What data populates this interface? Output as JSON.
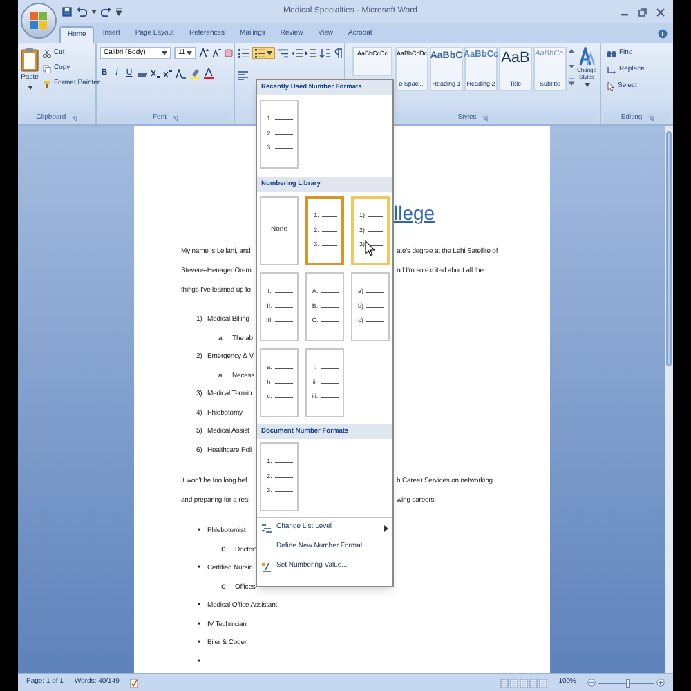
{
  "window": {
    "title": "Medical Specialties - Microsoft Word"
  },
  "ribbon_tabs": [
    {
      "label": "Home",
      "selected": true
    },
    {
      "label": "Insert",
      "selected": false
    },
    {
      "label": "Page Layout",
      "selected": false
    },
    {
      "label": "References",
      "selected": false
    },
    {
      "label": "Mailings",
      "selected": false
    },
    {
      "label": "Review",
      "selected": false
    },
    {
      "label": "View",
      "selected": false
    },
    {
      "label": "Acrobat",
      "selected": false
    }
  ],
  "clipboard": {
    "paste": "Paste",
    "cut": "Cut",
    "copy": "Copy",
    "format_painter": "Format Painter",
    "label": "Clipboard"
  },
  "font": {
    "name": "Calibri (Body)",
    "size": "11",
    "format_buttons": [
      "B",
      "I",
      "U"
    ],
    "label": "Font"
  },
  "paragraph": {
    "numbering_pressed": true
  },
  "styles": {
    "items": [
      {
        "kind": "normal",
        "sample": "AaBbCcDc"
      },
      {
        "kind": "normal",
        "sample": "AaBbCcDc",
        "label": "o Spaci..."
      },
      {
        "kind": "heading1",
        "sample": "AaBbC",
        "label": "Heading 1"
      },
      {
        "kind": "heading2",
        "sample": "AaBbCc",
        "label": "Heading 2"
      },
      {
        "kind": "title",
        "sample": "AaB",
        "label": "Title"
      },
      {
        "kind": "subtitle",
        "sample": "AaBbCc.",
        "label": "Subtitle"
      }
    ],
    "change_styles": "Change Styles",
    "label": "Styles"
  },
  "editing": {
    "find": "Find",
    "replace": "Replace",
    "select": "Select",
    "label": "Editing"
  },
  "document": {
    "heading": "llege",
    "blocks": [
      {
        "kind": "paragraph",
        "lines": [
          {
            "left": "My name is Leilani, and",
            "right": "ate's degree at the Lehi Satellite of"
          },
          {
            "left": "Stevens-Henager Orem",
            "right": "nd I'm so excited about all the"
          },
          {
            "left": "things I've learned up to"
          }
        ]
      },
      {
        "kind": "numbered",
        "items": [
          {
            "marker": "1)",
            "text": "Medical Billing",
            "children": [
              {
                "marker": "a.",
                "text": "The ab"
              }
            ]
          },
          {
            "marker": "2)",
            "text": "Emergency & V",
            "children": [
              {
                "marker": "a.",
                "text": "Necess"
              }
            ]
          },
          {
            "marker": "3)",
            "text": "Medical Termin"
          },
          {
            "marker": "4)",
            "text": "Phlebotomy"
          },
          {
            "marker": "5)",
            "text": "Medical Assist"
          },
          {
            "marker": "6)",
            "text": "Healthcare Poli"
          }
        ]
      },
      {
        "kind": "paragraph",
        "lines": [
          {
            "left": "It won't be too long bef",
            "right": "h Career Services on networking"
          },
          {
            "left": "and preparing for a real",
            "right": "wing careers:"
          }
        ]
      },
      {
        "kind": "bulleted",
        "items": [
          {
            "marker": "•",
            "text": "Phlebotomist",
            "children": [
              {
                "marker": "o",
                "text": "Doctor'"
              }
            ]
          },
          {
            "marker": "•",
            "text": "Certified Nursin",
            "children": [
              {
                "marker": "o",
                "text": "Offices"
              }
            ]
          },
          {
            "marker": "•",
            "text": "Medical Office Assistant"
          },
          {
            "marker": "•",
            "text": "IV Technician"
          },
          {
            "marker": "•",
            "text": "Biler & Coder"
          },
          {
            "marker": "•"
          }
        ]
      }
    ]
  },
  "numbering_menu": {
    "sections": [
      {
        "title": "Recently Used Number Formats",
        "formats": [
          {
            "kind": "list",
            "markers": [
              "1.",
              "2.",
              "3."
            ]
          }
        ]
      },
      {
        "title": "Numbering Library",
        "formats": [
          {
            "kind": "none",
            "label": "None",
            "selected": false,
            "hovered": false
          },
          {
            "kind": "list",
            "markers": [
              "1.",
              "2.",
              "3."
            ],
            "selected": true,
            "hovered": false
          },
          {
            "kind": "list",
            "markers": [
              "1)",
              "2)",
              "3)"
            ],
            "selected": false,
            "hovered": true
          },
          {
            "kind": "list",
            "markers": [
              "I.",
              "II.",
              "III."
            ],
            "selected": false,
            "hovered": false
          },
          {
            "kind": "list",
            "markers": [
              "A.",
              "B.",
              "C."
            ],
            "selected": false,
            "hovered": false
          },
          {
            "kind": "list",
            "markers": [
              "a)",
              "b)",
              "c)"
            ],
            "selected": false,
            "hovered": false
          },
          {
            "kind": "list",
            "markers": [
              "a.",
              "b.",
              "c."
            ],
            "selected": false,
            "hovered": false
          },
          {
            "kind": "list",
            "markers": [
              "i.",
              "ii.",
              "iii."
            ],
            "selected": false,
            "hovered": false
          }
        ]
      },
      {
        "title": "Document Number Formats",
        "formats": [
          {
            "kind": "list",
            "markers": [
              "1.",
              "2.",
              "3."
            ]
          }
        ]
      }
    ],
    "commands": [
      {
        "kind": "level",
        "label": "Change List Level",
        "submenu": true
      },
      {
        "kind": "define",
        "label": "Define New Number Format...",
        "submenu": false
      },
      {
        "kind": "value",
        "label": "Set Numbering Value...",
        "submenu": false
      }
    ]
  },
  "status_bar": {
    "page": "Page: 1 of 1",
    "words": "Words: 40/149",
    "zoom": "100%",
    "zoom_slider": {
      "level": 0.55
    }
  }
}
